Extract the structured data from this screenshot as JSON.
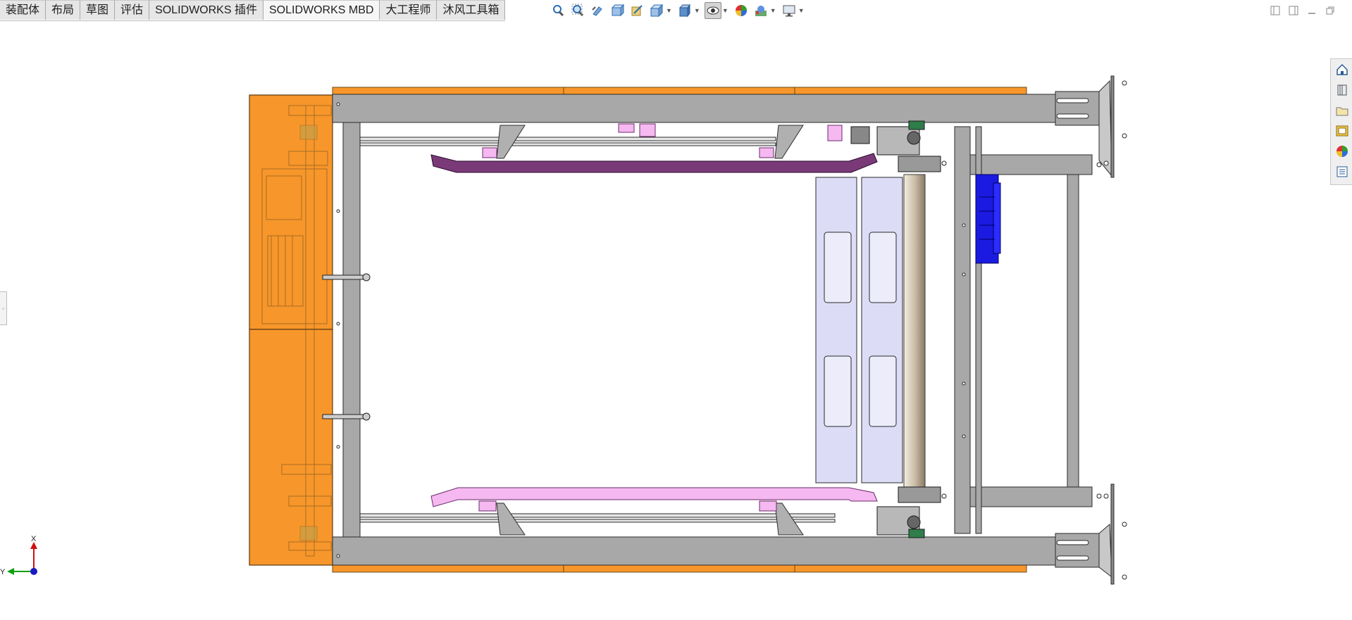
{
  "tabs": [
    {
      "label": "装配体",
      "active": false
    },
    {
      "label": "布局",
      "active": false
    },
    {
      "label": "草图",
      "active": false
    },
    {
      "label": "评估",
      "active": false
    },
    {
      "label": "SOLIDWORKS 插件",
      "active": false
    },
    {
      "label": "SOLIDWORKS MBD",
      "active": true
    },
    {
      "label": "大工程师",
      "active": false
    },
    {
      "label": "沐风工具箱",
      "active": false
    }
  ],
  "hud_toolbar": [
    "zoom-to-fit-icon",
    "zoom-to-area-icon",
    "previous-view-icon",
    "section-view-icon",
    "dynamic-annotation-icon",
    "view-orientation-icon",
    "display-style-icon",
    "hide-show-items-icon",
    "edit-appearance-icon",
    "apply-scene-icon",
    "view-settings-icon"
  ],
  "task_pane": [
    "home-icon",
    "design-library-icon",
    "file-explorer-icon",
    "view-palette-icon",
    "appearances-icon",
    "custom-properties-icon"
  ],
  "triad": {
    "x_label": "X",
    "y_label": "Y"
  },
  "colors": {
    "frame_orange": "#f7962a",
    "steel_gray": "#a8a8a8",
    "guide_purple": "#7a3a78",
    "guide_pink": "#f5b8f0",
    "motor_blue": "#1a1ae0",
    "panel_lavender": "#dcdcf6",
    "roller_tan": "#d9cdbd"
  }
}
